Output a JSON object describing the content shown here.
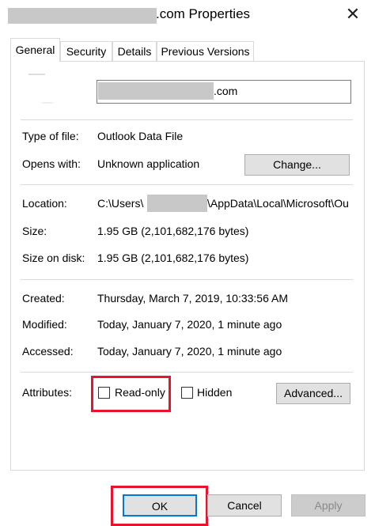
{
  "window": {
    "title": ".com Properties",
    "close_glyph": "✕"
  },
  "tabs": [
    {
      "label": "General"
    },
    {
      "label": "Security"
    },
    {
      "label": "Details"
    },
    {
      "label": "Previous Versions"
    }
  ],
  "general": {
    "file_name": ".com",
    "type_label": "Type of file:",
    "type_value": "Outlook Data File",
    "opens_label": "Opens with:",
    "opens_value": "Unknown application",
    "change_label": "Change...",
    "location_label": "Location:",
    "location_value_prefix": "C:\\Users\\",
    "location_value_suffix": "\\AppData\\Local\\Microsoft\\Ou",
    "size_label": "Size:",
    "size_value": "1.95 GB (2,101,682,176 bytes)",
    "size_on_disk_label": "Size on disk:",
    "size_on_disk_value": "1.95 GB (2,101,682,176 bytes)",
    "created_label": "Created:",
    "created_value": "Thursday, March 7, 2019, 10:33:56 AM",
    "modified_label": "Modified:",
    "modified_value": "Today, January 7, 2020, 1 minute ago",
    "accessed_label": "Accessed:",
    "accessed_value": "Today, January 7, 2020, 1 minute ago",
    "attributes_label": "Attributes:",
    "readonly_label": "Read-only",
    "hidden_label": "Hidden",
    "advanced_label": "Advanced..."
  },
  "footer": {
    "ok_label": "OK",
    "cancel_label": "Cancel",
    "apply_label": "Apply"
  },
  "colors": {
    "highlight": "#e8132c"
  },
  "icons": {
    "close": "close-icon",
    "file": "file-icon"
  }
}
